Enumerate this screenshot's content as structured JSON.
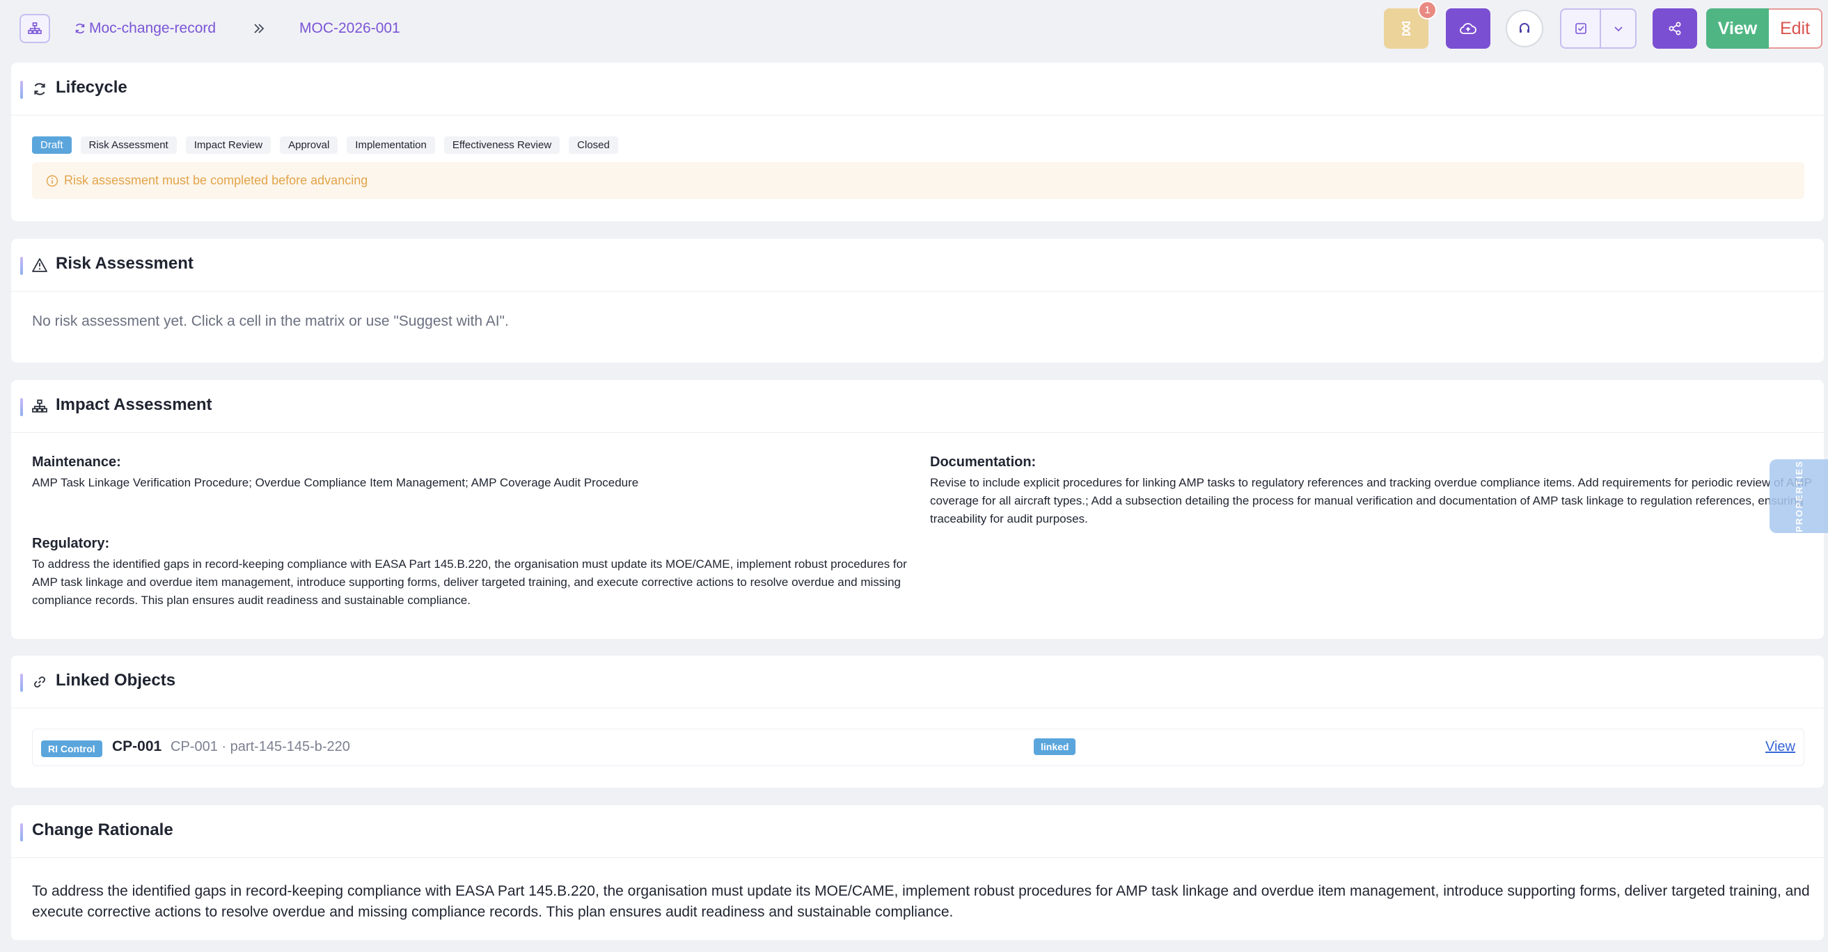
{
  "breadcrumb": {
    "parent": "Moc-change-record",
    "current": "MOC-2026-001"
  },
  "toolbar": {
    "pending_badge": "1",
    "view_label": "View",
    "edit_label": "Edit"
  },
  "lifecycle": {
    "title": "Lifecycle",
    "stages": [
      "Draft",
      "Risk Assessment",
      "Impact Review",
      "Approval",
      "Implementation",
      "Effectiveness Review",
      "Closed"
    ],
    "active_stage": "Draft",
    "warning": "Risk assessment must be completed before advancing"
  },
  "risk": {
    "title": "Risk Assessment",
    "empty_text": "No risk assessment yet. Click a cell in the matrix or use \"Suggest with AI\"."
  },
  "impact": {
    "title": "Impact Assessment",
    "maintenance_label": "Maintenance:",
    "maintenance_text": "AMP Task Linkage Verification Procedure; Overdue Compliance Item Management; AMP Coverage Audit Procedure",
    "regulatory_label": "Regulatory:",
    "regulatory_text": "To address the identified gaps in record-keeping compliance with EASA Part 145.B.220, the organisation must update its MOE/CAME, implement robust procedures for AMP task linkage and overdue item management, introduce supporting forms, deliver targeted training, and execute corrective actions to resolve overdue and missing compliance records. This plan ensures audit readiness and sustainable compliance.",
    "documentation_label": "Documentation:",
    "documentation_text": "Revise to include explicit procedures for linking AMP tasks to regulatory references and tracking overdue compliance items. Add requirements for periodic review of AMP coverage for all aircraft types.; Add a subsection detailing the process for manual verification and documentation of AMP task linkage to regulation references, ensuring traceability for audit purposes."
  },
  "linked": {
    "title": "Linked Objects",
    "items": [
      {
        "type": "RI Control",
        "code": "CP-001",
        "sub": "CP-001 · part-145-145-b-220",
        "status": "linked",
        "action": "View"
      }
    ]
  },
  "rationale": {
    "title": "Change Rationale",
    "text": "To address the identified gaps in record-keeping compliance with EASA Part 145.B.220, the organisation must update its MOE/CAME, implement robust procedures for AMP task linkage and overdue item management, introduce supporting forms, deliver targeted training, and execute corrective actions to resolve overdue and missing compliance records. This plan ensures audit readiness and sustainable compliance."
  },
  "properties_tab": "PROPERTIES",
  "colors": {
    "accent_purple": "#7b4fd2",
    "stage_active": "#5aa5dc",
    "view_green": "#4fb683",
    "edit_red": "#d9534f",
    "warning_text": "#e2a44a"
  }
}
